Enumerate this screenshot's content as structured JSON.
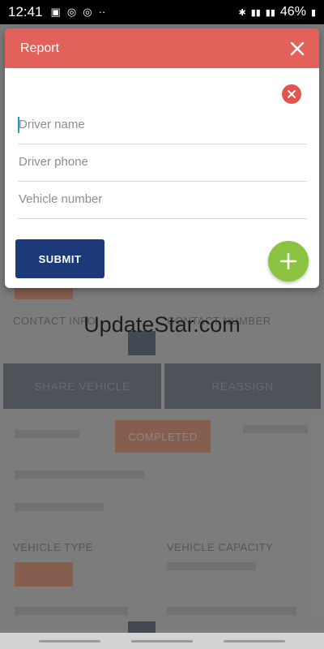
{
  "status_bar": {
    "time": "12:41",
    "network_1": "Vo)) LTE\nLTE1",
    "network_2": "Vo)) LTE2",
    "battery": "46%"
  },
  "background": {
    "row1_text": "CONTACT INFO",
    "row1_text2": "CONTACT NUMBER",
    "share_vehicle": "SHARE VEHICLE",
    "reassign": "REASSIGN",
    "status_label": "COMPLETED",
    "vehicle_type_label": "VEHICLE TYPE",
    "vehicle_capacity_label": "VEHICLE CAPACITY"
  },
  "watermark": "UpdateStar.com",
  "dialog": {
    "title": "Report",
    "fields": {
      "driver_name_placeholder": "Driver name",
      "driver_phone_placeholder": "Driver phone",
      "vehicle_number_placeholder": "Vehicle number"
    },
    "submit_label": "SUBMIT"
  },
  "colors": {
    "header": "#e2615a",
    "submit": "#1d3a78",
    "add": "#8bc23f",
    "remove": "#e2544c"
  }
}
